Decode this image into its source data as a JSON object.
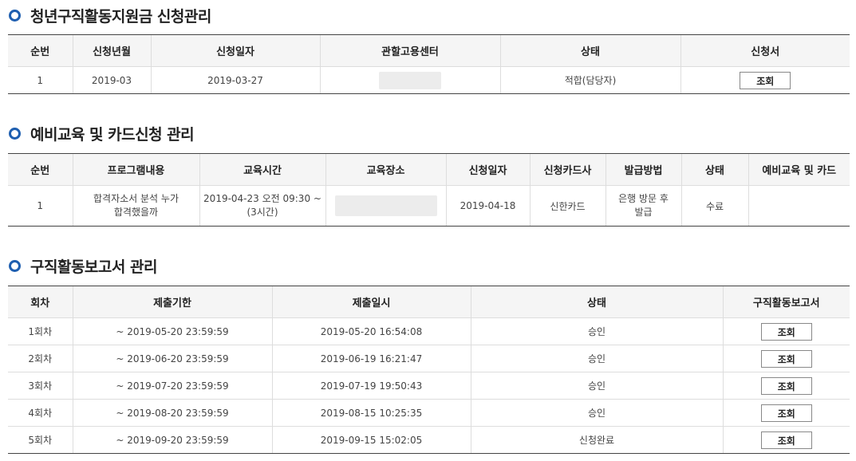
{
  "section1": {
    "title": "청년구직활동지원금 신청관리",
    "headers": [
      "순번",
      "신청년월",
      "신청일자",
      "관할고용센터",
      "상태",
      "신청서"
    ],
    "rows": [
      {
        "no": "1",
        "month": "2019-03",
        "date": "2019-03-27",
        "status": "적합(담당자)",
        "button": "조회"
      }
    ]
  },
  "section2": {
    "title": "예비교육 및 카드신청 관리",
    "headers": [
      "순번",
      "프로그램내용",
      "교육시간",
      "교육장소",
      "신청일자",
      "신청카드사",
      "발급방법",
      "상태",
      "예비교육 및 카드"
    ],
    "rows": [
      {
        "no": "1",
        "program": "합격자소서 분석 누가 합격했을까",
        "time_line1": "2019-04-23 오전 09:30 ~",
        "time_line2": "(3시간)",
        "date": "2019-04-18",
        "card": "신한카드",
        "method": "은행 방문 후 발급",
        "status": "수료"
      }
    ]
  },
  "section3": {
    "title": "구직활동보고서 관리",
    "headers": [
      "회차",
      "제출기한",
      "제출일시",
      "상태",
      "구직활동보고서"
    ],
    "rows": [
      {
        "round": "1회차",
        "deadline": "~ 2019-05-20 23:59:59",
        "submitted": "2019-05-20 16:54:08",
        "status": "승인",
        "button": "조회"
      },
      {
        "round": "2회차",
        "deadline": "~ 2019-06-20 23:59:59",
        "submitted": "2019-06-19 16:21:47",
        "status": "승인",
        "button": "조회"
      },
      {
        "round": "3회차",
        "deadline": "~ 2019-07-20 23:59:59",
        "submitted": "2019-07-19 19:50:43",
        "status": "승인",
        "button": "조회"
      },
      {
        "round": "4회차",
        "deadline": "~ 2019-08-20 23:59:59",
        "submitted": "2019-08-15 10:25:35",
        "status": "승인",
        "button": "조회"
      },
      {
        "round": "5회차",
        "deadline": "~ 2019-09-20 23:59:59",
        "submitted": "2019-09-15 15:02:05",
        "status": "신청완료",
        "button": "조회"
      }
    ]
  },
  "colors": {
    "accent": "#1f5fb0",
    "header_bg": "#f5f5f5"
  }
}
